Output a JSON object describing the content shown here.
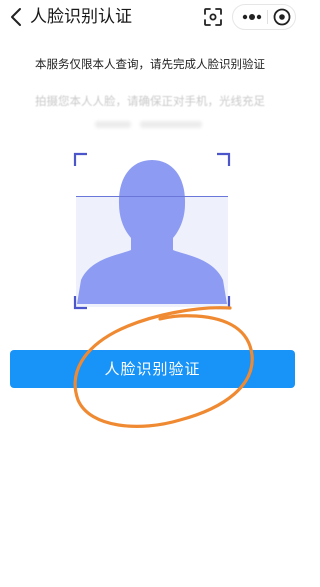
{
  "navbar": {
    "title": "人脸识别认证",
    "icons": [
      "back-chevron",
      "scan-icon",
      "more-icon",
      "close-circle-icon"
    ]
  },
  "content": {
    "notice": "本服务仅限本人查询，请先完成人脸识别验证",
    "hint": "拍摄您本人人脸，请确保正对手机，光线充足"
  },
  "verify_button": {
    "label": "人脸识别验证"
  },
  "colors": {
    "primary_button": "#1893f8",
    "face_silhouette": "#8d9cf2",
    "frame_corners": "#4a56c9",
    "annotation": "#f08a32"
  }
}
